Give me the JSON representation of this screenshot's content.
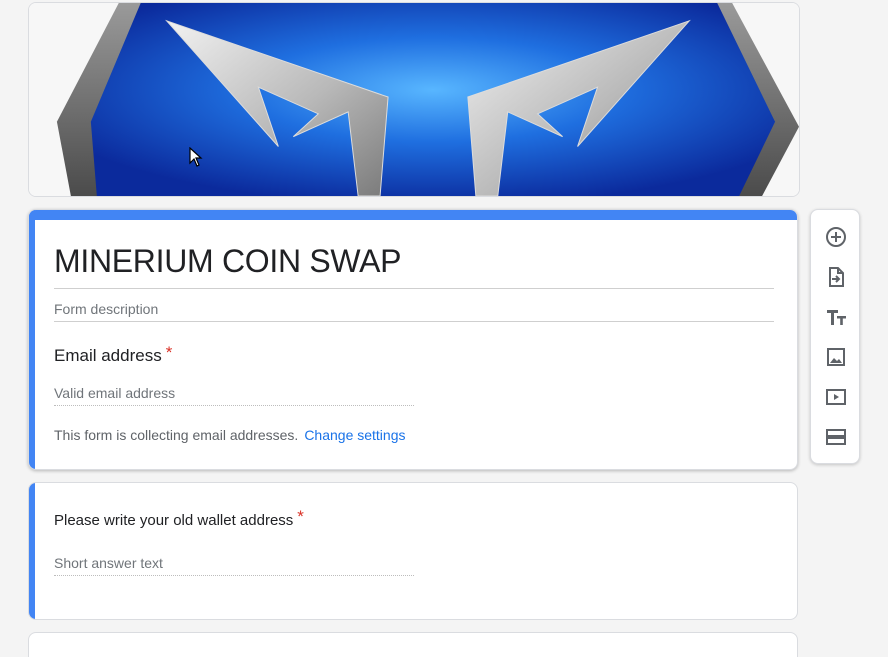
{
  "form": {
    "title": "MINERIUM COIN SWAP",
    "description_placeholder": "Form description"
  },
  "email_question": {
    "label": "Email address",
    "required_mark": "*",
    "placeholder": "Valid email address",
    "collecting_note": "This form is collecting email addresses.",
    "change_settings_link": "Change settings"
  },
  "wallet_question": {
    "label": "Please write your old wallet address",
    "required_mark": "*",
    "placeholder": "Short answer text"
  },
  "toolbar": {
    "tools": [
      "add-question-icon",
      "import-questions-icon",
      "add-title-icon",
      "add-image-icon",
      "add-video-icon",
      "add-section-icon"
    ]
  },
  "colors": {
    "accent": "#4285f4",
    "required": "#d93025",
    "link": "#1a73e8"
  }
}
